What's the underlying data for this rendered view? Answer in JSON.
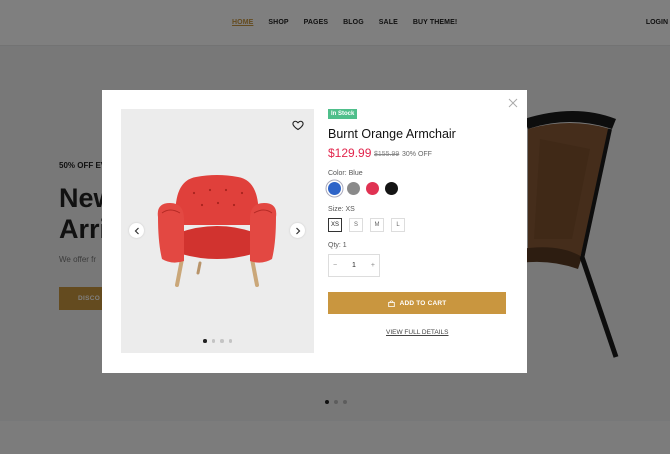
{
  "nav": {
    "items": [
      "HOME",
      "SHOP",
      "PAGES",
      "BLOG",
      "SALE",
      "BUY THEME!"
    ],
    "login": "LOGIN"
  },
  "hero": {
    "promo": "50% OFF EV",
    "headline_line1": "New",
    "headline_line2": "Arri",
    "subtitle": "We offer fr",
    "cta": "DISCO",
    "slide_dots": 3,
    "active_slide": 1
  },
  "modal": {
    "badge": "In Stock",
    "title": "Burnt Orange Armchair",
    "price": "$129.99",
    "old_price": "$155.99",
    "discount": "30% OFF",
    "color_label": "Color: Blue",
    "colors": [
      {
        "name": "Blue",
        "hex": "#2e64c8"
      },
      {
        "name": "Gray",
        "hex": "#8a8a8a"
      },
      {
        "name": "Red",
        "hex": "#e03252"
      },
      {
        "name": "Black",
        "hex": "#141414"
      }
    ],
    "selected_color": "Blue",
    "size_label": "Size: XS",
    "sizes": [
      "XS",
      "S",
      "M",
      "L"
    ],
    "selected_size": "XS",
    "qty_label": "Qty: 1",
    "qty_value": "1",
    "minus": "−",
    "plus": "+",
    "add_to_cart": "ADD TO CART",
    "view_details": "VIEW FULL DETAILS",
    "gallery_dots": 4,
    "active_gallery_dot": 1
  },
  "colors": {
    "accent": "#c9963f",
    "price": "#e2264d",
    "badge": "#4fbf8b"
  }
}
